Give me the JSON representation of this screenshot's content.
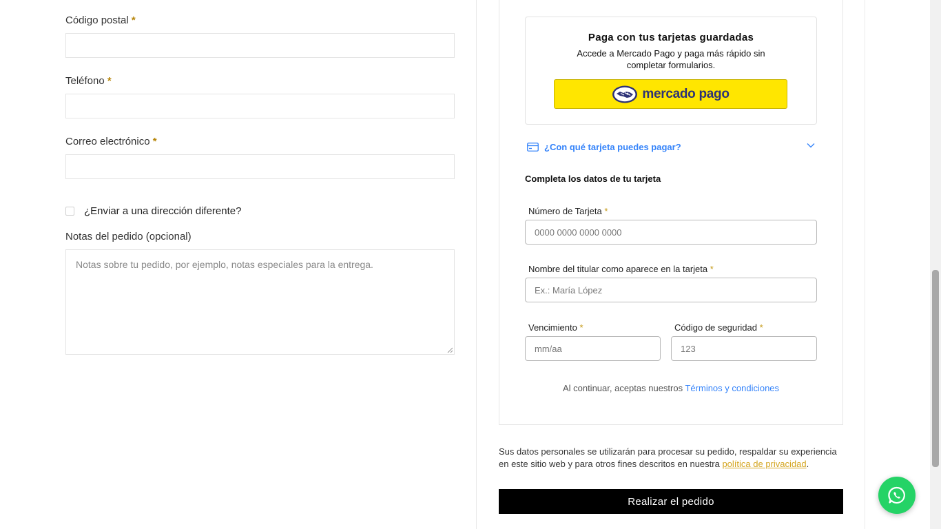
{
  "billing": {
    "required_mark": "*",
    "postcode_label": "Código postal",
    "phone_label": "Teléfono",
    "email_label": "Correo electrónico",
    "ship_different_label": "¿Enviar a una dirección diferente?",
    "notes_label": "Notas del pedido (opcional)",
    "notes_placeholder": "Notas sobre tu pedido, por ejemplo, notas especiales para la entrega."
  },
  "mercadopago": {
    "saved_cards_title": "Paga con tus tarjetas guardadas",
    "saved_cards_desc": "Accede a Mercado Pago y paga más rápido sin completar formularios.",
    "button_logo_text": "mercado pago",
    "cards_link": "¿Con qué tarjeta puedes pagar?",
    "card_section_title": "Completa los datos de tu tarjeta",
    "card_number_label": "Número de Tarjeta",
    "card_number_placeholder": "0000 0000 0000 0000",
    "holder_label": "Nombre del titular como aparece en la tarjeta",
    "holder_placeholder": "Ex.: María López",
    "expiry_label": "Vencimiento",
    "expiry_placeholder": "mm/aa",
    "cvv_label": "Código de seguridad",
    "cvv_placeholder": "123",
    "terms_prefix": "Al continuar, aceptas nuestros ",
    "terms_link": "Términos y condiciones"
  },
  "checkout": {
    "privacy_text": "Sus datos personales se utilizarán para procesar su pedido, respaldar su experiencia en este sitio web y para otros fines descritos en nuestra ",
    "privacy_link": "política de privacidad",
    "privacy_end": ".",
    "place_order": "Realizar el pedido"
  },
  "colors": {
    "accent_blue": "#3483fa",
    "mp_yellow": "#ffe600",
    "whatsapp_green": "#25d366",
    "required_gold": "#b7860b"
  },
  "icons": {
    "card": "credit-card-icon",
    "chevron": "chevron-down-icon",
    "handshake": "handshake-icon",
    "whatsapp": "whatsapp-icon"
  }
}
